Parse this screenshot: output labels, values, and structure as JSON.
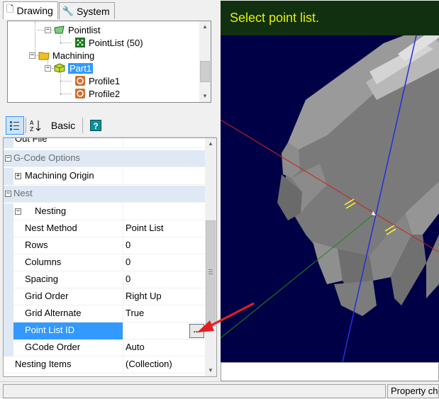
{
  "tabs": [
    {
      "label": "Drawing",
      "icon": "document-icon",
      "active": true
    },
    {
      "label": "System",
      "icon": "wrench-icon",
      "active": false
    }
  ],
  "tree": {
    "pointlist": "Pointlist",
    "pointlist_child": "PointList (50)",
    "machining": "Machining",
    "part1": "Part1",
    "profile1": "Profile1",
    "profile2": "Profile2"
  },
  "toolbar": {
    "categorized_icon": "categorized-icon",
    "alphabetical_icon": "sort-az-icon",
    "basic_label": "Basic",
    "help_icon": "help-icon",
    "help_glyph": "?"
  },
  "properties": {
    "out_file": "Out File",
    "cat_gcode": "G-Code Options",
    "machining_origin": "Machining Origin",
    "cat_nest": "Nest",
    "nesting": "Nesting",
    "rows": [
      {
        "name": "Nest Method",
        "value": "Point List"
      },
      {
        "name": "Rows",
        "value": "0"
      },
      {
        "name": "Columns",
        "value": "0"
      },
      {
        "name": "Spacing",
        "value": "0"
      },
      {
        "name": "Grid Order",
        "value": "Right Up"
      },
      {
        "name": "Grid Alternate",
        "value": "True"
      },
      {
        "name": "Point List ID",
        "value": ""
      },
      {
        "name": "GCode Order",
        "value": "Auto"
      }
    ],
    "nesting_items": "Nesting Items",
    "nesting_items_value": "(Collection)",
    "ellipsis": "..."
  },
  "viewport": {
    "prompt": "Select point list."
  },
  "status": {
    "property_changed": "Property cha"
  },
  "colors": {
    "selection": "#3399ff",
    "viewport_bg": "#000046",
    "prompt_text": "#e8f000",
    "annotation_arrow": "#e02020"
  }
}
